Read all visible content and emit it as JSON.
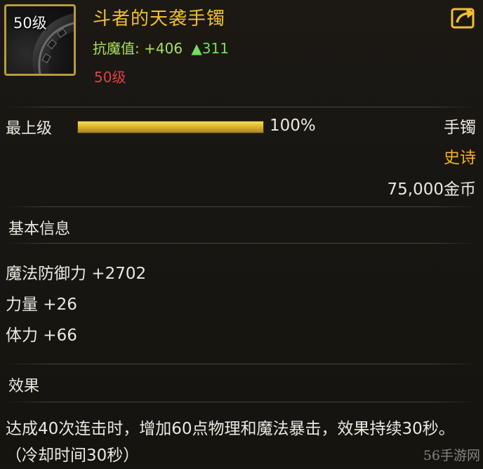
{
  "item": {
    "level_tag": "50级",
    "name": "斗者的天袭手镯",
    "stat_label": "抗魔值:",
    "stat_value": "+406",
    "stat_delta": "▲311",
    "required_level": "50级"
  },
  "upgrade": {
    "label": "最上级",
    "progress_percent": 100,
    "progress_text": "100%"
  },
  "meta": {
    "type": "手镯",
    "rarity": "史诗",
    "price": "75,000金币"
  },
  "basic_info": {
    "title": "基本信息",
    "attributes": [
      "魔法防御力 +2702",
      "力量 +26",
      "体力 +66"
    ]
  },
  "effect": {
    "title": "效果",
    "text": "达成40次连击时，增加60点物理和魔法暴击，效果持续30秒。（冷却时间30秒）"
  },
  "watermark": "56手游网",
  "colors": {
    "item_name": "#f0c030",
    "stat": "#a8e05c",
    "required_level": "#e0404a",
    "rarity": "#f0b020",
    "icon_border": "#b89a3e",
    "progress_fill": "#e0b82a"
  },
  "icons": {
    "share": "share-arrow-icon",
    "item": "bracelet-item-icon"
  }
}
